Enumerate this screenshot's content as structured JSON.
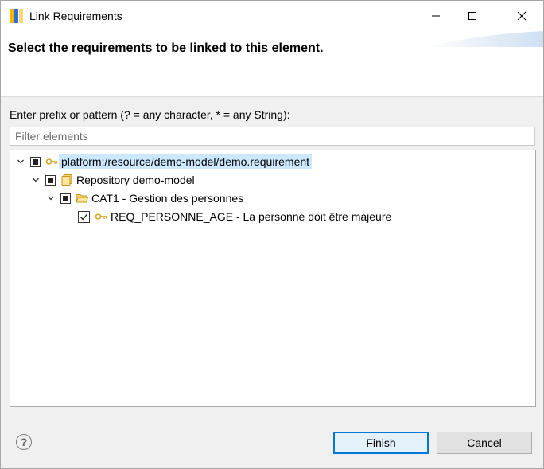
{
  "window": {
    "title": "Link Requirements",
    "minimize_icon": "minimize-icon",
    "maximize_icon": "maximize-icon",
    "close_icon": "close-icon"
  },
  "header": {
    "title": "Select the requirements to be linked to this element."
  },
  "filter": {
    "label": "Enter prefix or pattern (? = any character, * = any String):",
    "placeholder": "Filter elements",
    "value": ""
  },
  "tree": [
    {
      "label": "platform:/resource/demo-model/demo.requirement",
      "level": 0,
      "expanded": true,
      "check": "partial",
      "icon": "key-icon",
      "selected": true
    },
    {
      "label": "Repository demo-model",
      "level": 1,
      "expanded": true,
      "check": "partial",
      "icon": "repository-icon",
      "selected": false
    },
    {
      "label": "CAT1 - Gestion des personnes",
      "level": 2,
      "expanded": true,
      "check": "partial",
      "icon": "folder-icon",
      "selected": false
    },
    {
      "label": "REQ_PERSONNE_AGE - La personne doit être majeure",
      "level": 3,
      "expanded": null,
      "check": "checked",
      "icon": "key-icon",
      "selected": false
    }
  ],
  "footer": {
    "help": "?",
    "finish_label": "Finish",
    "cancel_label": "Cancel"
  },
  "colors": {
    "selection": "#cce8ff",
    "default_button_border": "#0078d7",
    "icon_gold": "#d9a520"
  }
}
